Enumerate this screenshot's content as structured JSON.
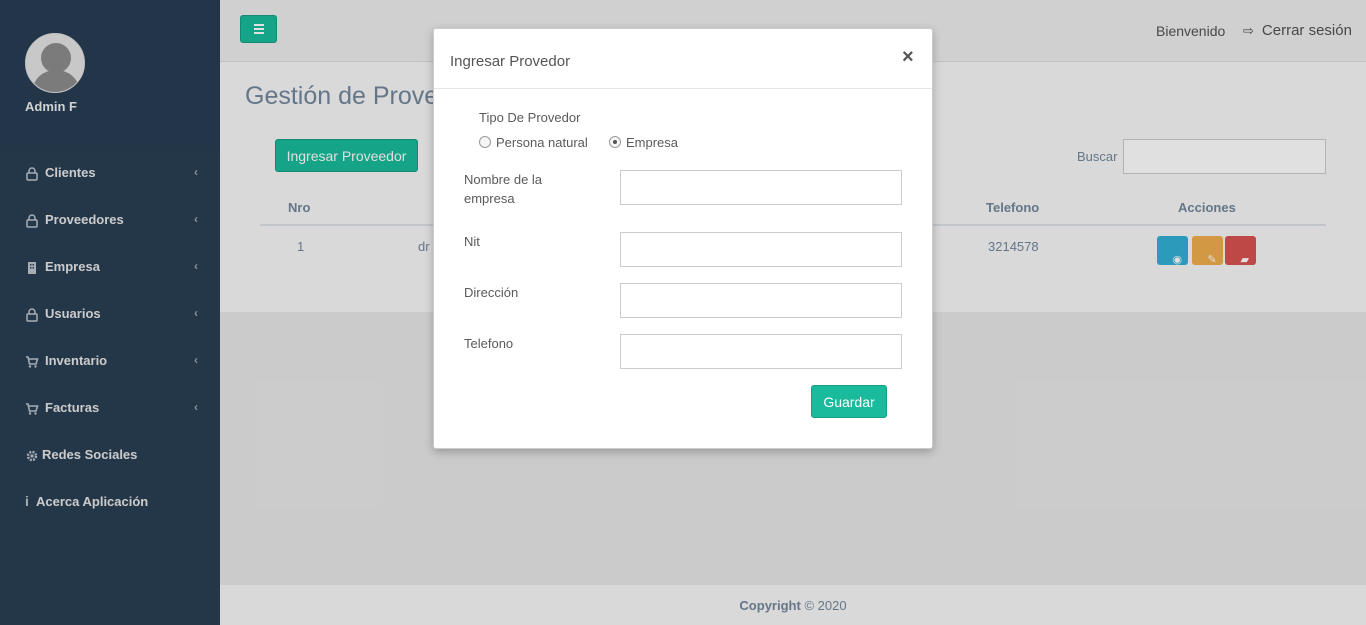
{
  "sidebar": {
    "profile_name": "Admin F",
    "items": [
      {
        "label": "Clientes",
        "icon": "lock-icon",
        "has_submenu": true
      },
      {
        "label": "Proveedores",
        "icon": "lock-icon",
        "has_submenu": true
      },
      {
        "label": "Empresa",
        "icon": "building-icon",
        "has_submenu": true
      },
      {
        "label": "Usuarios",
        "icon": "lock-icon",
        "has_submenu": true
      },
      {
        "label": "Inventario",
        "icon": "cart-icon",
        "has_submenu": true
      },
      {
        "label": "Facturas",
        "icon": "cart-icon",
        "has_submenu": true
      },
      {
        "label": "Redes Sociales",
        "icon": "gear-icon",
        "has_submenu": false
      },
      {
        "label": "Acerca Aplicación",
        "icon": "info-icon",
        "has_submenu": false
      }
    ]
  },
  "topnav": {
    "welcome": "Bienvenido",
    "logout": "Cerrar sesión"
  },
  "main": {
    "title": "Gestión de Prove",
    "add_button": "Ingresar Proveedor",
    "search_label": "Buscar",
    "table": {
      "headers": {
        "nro": "Nro",
        "telefono": "Telefono",
        "acciones": "Acciones"
      },
      "rows": [
        {
          "nro": "1",
          "nombre": "dr",
          "telefono": "3214578"
        }
      ]
    }
  },
  "footer": {
    "copyright_bold": "Copyright",
    "copyright_rest": "© 2020"
  },
  "modal": {
    "title": "Ingresar Provedor",
    "close": "×",
    "tipo_label": "Tipo De Provedor",
    "radio_natural": "Persona natural",
    "radio_empresa": "Empresa",
    "selected_type": "Empresa",
    "field_nombre_line1": "Nombre de la",
    "field_nombre_line2": "empresa",
    "field_nit": "Nit",
    "field_direccion": "Dirección",
    "field_telefono": "Telefono",
    "save_button": "Guardar"
  },
  "colors": {
    "sidebar_bg": "#2a3f54",
    "accent": "#1abb9c",
    "info": "#31b0d5",
    "warning": "#f0ad4e",
    "danger": "#d9534f"
  }
}
